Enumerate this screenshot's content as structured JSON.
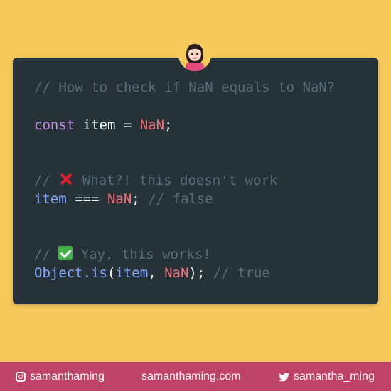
{
  "colors": {
    "background": "#f7c85c",
    "footer": "#bd4466",
    "code_bg": "#263238"
  },
  "code": {
    "line1_comment": "// How to check if NaN equals to NaN?",
    "line2": {
      "kw": "const",
      "ident": " item = ",
      "value": "NaN",
      "end": ";"
    },
    "line3": {
      "prefix": "// ",
      "text": " What?! this doesn't work"
    },
    "line4": {
      "ident": "item",
      "op": " === ",
      "value": "NaN",
      "end": ";",
      "comment": " // false"
    },
    "line5": {
      "prefix": "// ",
      "text": " Yay, this works!"
    },
    "line6": {
      "obj": "Object.is",
      "open": "(",
      "arg1": "item",
      "sep": ", ",
      "arg2": "NaN",
      "close": ");",
      "comment": " // true"
    }
  },
  "icons": {
    "avatar": "avatar-icon",
    "cross": "cross-mark-icon",
    "check": "check-mark-icon",
    "instagram": "instagram-icon",
    "twitter": "twitter-icon"
  },
  "footer": {
    "instagram": "samanthaming",
    "website": "samanthaming.com",
    "twitter": "samantha_ming"
  }
}
